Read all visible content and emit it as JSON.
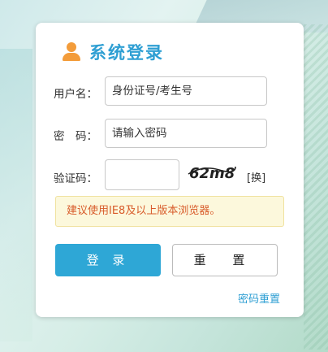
{
  "header": {
    "title": "系统登录",
    "icon": "user-icon"
  },
  "form": {
    "username": {
      "label": "用户名：",
      "placeholder": "身份证号/考生号"
    },
    "password": {
      "label": "密　码：",
      "placeholder": "请输入密码"
    },
    "captcha": {
      "label": "验证码：",
      "value": "",
      "image_text": "62m8",
      "switch_label": "[换]"
    }
  },
  "notice": "建议使用IE8及以上版本浏览器。",
  "buttons": {
    "login": "登 录",
    "reset": "重 置"
  },
  "links": {
    "reset_password": "密码重置"
  },
  "colors": {
    "accent": "#2ea7d6",
    "title": "#2f9fd3",
    "icon": "#f39c3a",
    "notice_text": "#d85b2a",
    "notice_bg": "#fcf8dc"
  }
}
